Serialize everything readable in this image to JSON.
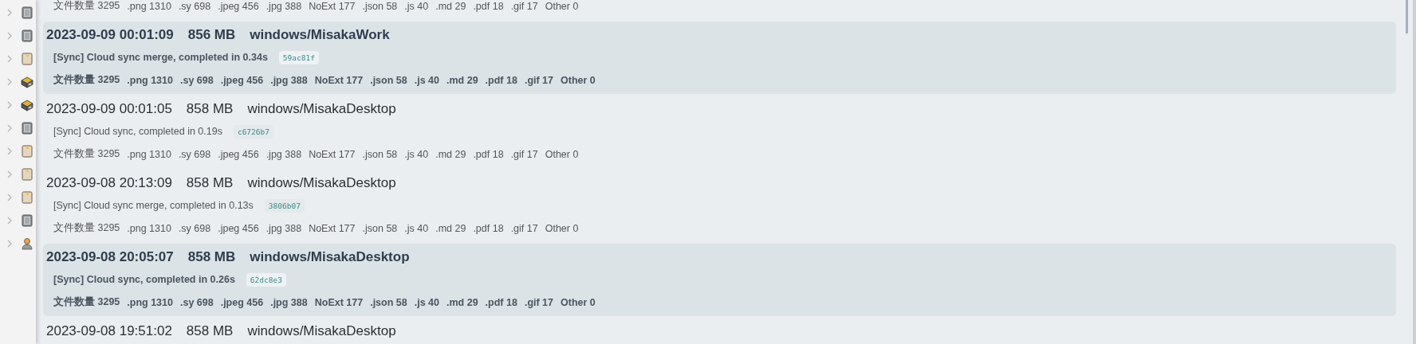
{
  "sidebar": {
    "items": [
      {
        "kind": "grey-book",
        "expanded": false
      },
      {
        "kind": "grey-book",
        "expanded": false
      },
      {
        "kind": "beige-book",
        "expanded": false
      },
      {
        "kind": "box",
        "expanded": false
      },
      {
        "kind": "box",
        "expanded": false
      },
      {
        "kind": "grey-book",
        "expanded": false
      },
      {
        "kind": "beige-book",
        "expanded": false
      },
      {
        "kind": "beige-book",
        "expanded": false
      },
      {
        "kind": "beige-book",
        "expanded": false
      },
      {
        "kind": "grey-book",
        "expanded": false
      },
      {
        "kind": "person",
        "expanded": false
      }
    ]
  },
  "history": [
    {
      "highlighted": false,
      "files": [
        "文件数量 3295",
        ".png 1310",
        ".sy 698",
        ".jpeg 456",
        ".jpg 388",
        "NoExt 177",
        ".json 58",
        ".js 40",
        ".md 29",
        ".pdf 18",
        ".gif 17",
        "Other 0"
      ]
    },
    {
      "highlighted": true,
      "time": "2023-09-09 00:01:09",
      "size": "856 MB",
      "device": "windows/MisakaWork",
      "message": "[Sync] Cloud sync merge, completed in 0.34s",
      "hash": "59ac81f",
      "files": [
        "文件数量 3295",
        ".png 1310",
        ".sy 698",
        ".jpeg 456",
        ".jpg 388",
        "NoExt 177",
        ".json 58",
        ".js 40",
        ".md 29",
        ".pdf 18",
        ".gif 17",
        "Other 0"
      ]
    },
    {
      "highlighted": false,
      "time": "2023-09-09 00:01:05",
      "size": "858 MB",
      "device": "windows/MisakaDesktop",
      "message": "[Sync] Cloud sync, completed in 0.19s",
      "hash": "c6726b7",
      "files": [
        "文件数量 3295",
        ".png 1310",
        ".sy 698",
        ".jpeg 456",
        ".jpg 388",
        "NoExt 177",
        ".json 58",
        ".js 40",
        ".md 29",
        ".pdf 18",
        ".gif 17",
        "Other 0"
      ]
    },
    {
      "highlighted": false,
      "time": "2023-09-08 20:13:09",
      "size": "858 MB",
      "device": "windows/MisakaDesktop",
      "message": "[Sync] Cloud sync merge, completed in 0.13s",
      "hash": "3806b07",
      "files": [
        "文件数量 3295",
        ".png 1310",
        ".sy 698",
        ".jpeg 456",
        ".jpg 388",
        "NoExt 177",
        ".json 58",
        ".js 40",
        ".md 29",
        ".pdf 18",
        ".gif 17",
        "Other 0"
      ]
    },
    {
      "highlighted": true,
      "time": "2023-09-08 20:05:07",
      "size": "858 MB",
      "device": "windows/MisakaDesktop",
      "message": "[Sync] Cloud sync, completed in 0.26s",
      "hash": "62dc8e3",
      "files": [
        "文件数量 3295",
        ".png 1310",
        ".sy 698",
        ".jpeg 456",
        ".jpg 388",
        "NoExt 177",
        ".json 58",
        ".js 40",
        ".md 29",
        ".pdf 18",
        ".gif 17",
        "Other 0"
      ]
    },
    {
      "highlighted": false,
      "time": "2023-09-08 19:51:02",
      "size": "858 MB",
      "device": "windows/MisakaDesktop"
    }
  ]
}
